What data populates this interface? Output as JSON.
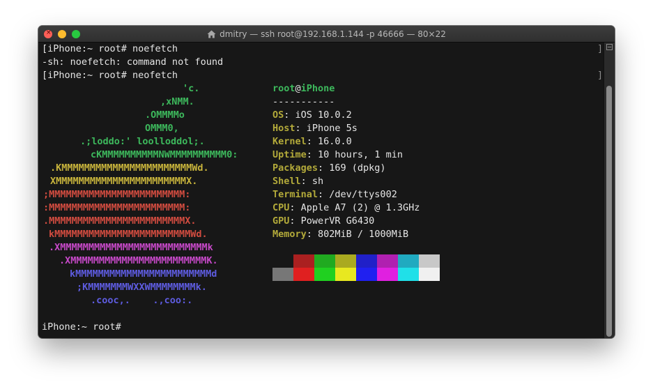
{
  "window": {
    "title": "dmitry — ssh root@192.168.1.144 -p 46666 — 80×22"
  },
  "terminal": {
    "lines": [
      "[iPhone:~ root# noefetch",
      "-sh: noefetch: command not found",
      "[iPhone:~ root# neofetch"
    ],
    "ascii_art": [
      {
        "text": "'c.",
        "color": "#3db85c"
      },
      {
        "text": ",xNMM.",
        "color": "#3db85c"
      },
      {
        "text": ".OMMMMo",
        "color": "#3db85c"
      },
      {
        "text": "OMMM0,",
        "color": "#3db85c"
      },
      {
        "text": ".;loddo:' loolloddol;.",
        "color": "#3db85c"
      },
      {
        "text": "cKMMMMMMMMMMNWMMMMMMMMMM0:",
        "color": "#3db85c"
      },
      {
        "text": ".KMMMMMMMMMMMMMMMMMMMMMMMWd.",
        "color": "#c8b43c"
      },
      {
        "text": "XMMMMMMMMMMMMMMMMMMMMMMMX.",
        "color": "#c8b43c"
      },
      {
        "text": ";MMMMMMMMMMMMMMMMMMMMMMMM:",
        "color": "#d24c40"
      },
      {
        "text": ":MMMMMMMMMMMMMMMMMMMMMMMM:",
        "color": "#d24c40"
      },
      {
        "text": ".MMMMMMMMMMMMMMMMMMMMMMMMX.",
        "color": "#d24c40"
      },
      {
        "text": "kMMMMMMMMMMMMMMMMMMMMMMMMWd.",
        "color": "#d24c40"
      },
      {
        "text": ".XMMMMMMMMMMMMMMMMMMMMMMMMMMk",
        "color": "#c749c9"
      },
      {
        "text": ".XMMMMMMMMMMMMMMMMMMMMMMMMK.",
        "color": "#c749c9"
      },
      {
        "text": "kMMMMMMMMMMMMMMMMMMMMMMMMd",
        "color": "#5e5ce0"
      },
      {
        "text": ";KMMMMMMMWXXWMMMMMMMMk.",
        "color": "#5e5ce0"
      },
      {
        "text": ".cooc,.    .,coo:.",
        "color": "#5e5ce0"
      }
    ],
    "info": {
      "user": "root",
      "at": "@",
      "host": "iPhone",
      "separator": "-----------",
      "fields": [
        {
          "key": "OS",
          "value": ": iOS 10.0.2"
        },
        {
          "key": "Host",
          "value": ": iPhone 5s"
        },
        {
          "key": "Kernel",
          "value": ": 16.0.0"
        },
        {
          "key": "Uptime",
          "value": ": 10 hours, 1 min"
        },
        {
          "key": "Packages",
          "value": ": 169 (dpkg)"
        },
        {
          "key": "Shell",
          "value": ": sh"
        },
        {
          "key": "Terminal",
          "value": ": /dev/ttys002"
        },
        {
          "key": "CPU",
          "value": ": Apple A7 (2) @ 1.3GHz"
        },
        {
          "key": "GPU",
          "value": ": PowerVR G6430"
        },
        {
          "key": "Memory",
          "value": ": 802MiB / 1000MiB"
        }
      ]
    },
    "palette_top": [
      "#171717",
      "#aa2020",
      "#20aa20",
      "#aaaa20",
      "#2020c8",
      "#b020b0",
      "#20aac0",
      "#c8c8c8"
    ],
    "palette_bottom": [
      "#777777",
      "#e02020",
      "#20d020",
      "#e8e820",
      "#2020f0",
      "#e020e0",
      "#20e0e8",
      "#f0f0f0"
    ],
    "prompt": "iPhone:~ root# "
  }
}
